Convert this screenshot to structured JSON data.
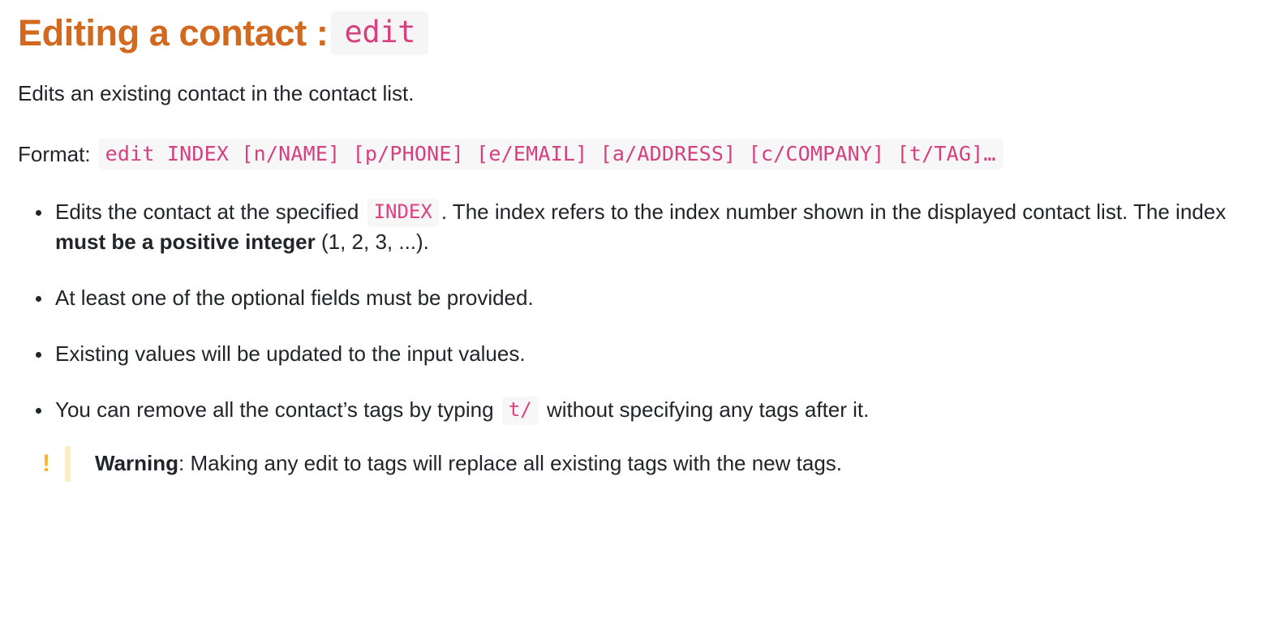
{
  "heading": {
    "text": "Editing a contact",
    "separator": " :",
    "command": "edit"
  },
  "intro": "Edits an existing contact in the contact list.",
  "format": {
    "label": "Format:",
    "value": "edit INDEX [n/NAME] [p/PHONE] [e/EMAIL] [a/ADDRESS] [c/COMPANY] [t/TAG]…"
  },
  "bullets": [
    {
      "part1": "Edits the contact at the specified",
      "code": "INDEX",
      "part2": ". The index refers to the index number shown in the displayed contact list. The index ",
      "bold": "must be a positive integer",
      "part3": " (1, 2, 3, ...)."
    },
    {
      "part1": "At least one of the optional fields must be provided."
    },
    {
      "part1": "Existing values will be updated to the input values."
    },
    {
      "part1": "You can remove all the contact’s tags by typing",
      "code": "t/",
      "part2": "without specifying any tags after it."
    }
  ],
  "warning": {
    "icon": "!",
    "label": "Warning",
    "separator": ": ",
    "text": "Making any edit to tags will replace all existing tags with the new tags."
  },
  "colors": {
    "heading": "#d2691e",
    "code_text": "#d6407f",
    "code_background": "#f5f5f5",
    "body_text": "#212529",
    "warning_icon": "#f5b731",
    "warning_bar": "#fbeec6"
  }
}
